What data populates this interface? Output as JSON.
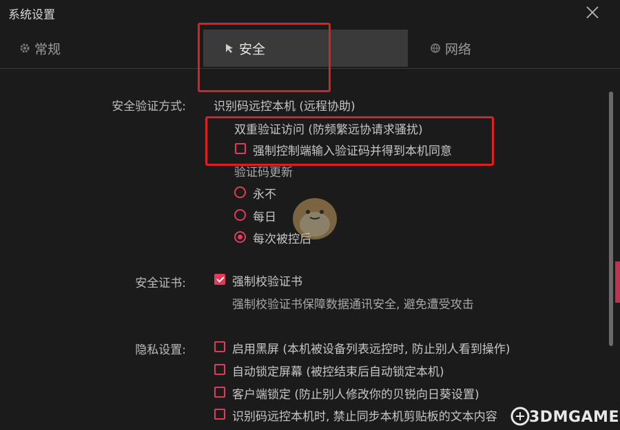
{
  "window": {
    "title": "系统设置"
  },
  "tabs": [
    {
      "label": "常规",
      "icon": "gear-icon"
    },
    {
      "label": "安全",
      "icon": "shield-arrow-icon"
    },
    {
      "label": "网络",
      "icon": "globe-icon"
    }
  ],
  "security": {
    "verify_method": {
      "label": "安全验证方式:",
      "value": "识别码远控本机 (远程协助)",
      "double_verify_title": "双重验证访问 (防频繁远协请求骚扰)",
      "force_code_option": "强制控制端输入验证码并得到本机同意",
      "force_code_checked": false,
      "code_update_title": "验证码更新",
      "code_update_options": [
        "永不",
        "每日",
        "每次被控后"
      ],
      "code_update_selected": "每次被控后"
    },
    "certificate": {
      "label": "安全证书:",
      "option": "强制校验证书",
      "checked": true,
      "description": "强制校验证书保障数据通讯安全, 避免遭受攻击"
    },
    "privacy": {
      "label": "隐私设置:",
      "options": [
        {
          "label": "启用黑屏 (本机被设备列表远控时, 防止别人看到操作)",
          "checked": false
        },
        {
          "label": "自动锁定屏幕 (被控结束后自动锁定本机)",
          "checked": false
        },
        {
          "label": "客户端锁定 (防止别人修改你的贝锐向日葵设置)",
          "checked": false
        },
        {
          "label": "识别码远控本机时, 禁止同步本机剪贴板的文本内容",
          "checked": false
        }
      ]
    }
  },
  "watermark": {
    "text": "3DMGAME"
  },
  "colors": {
    "accent": "#e5395a",
    "highlight_box": "#e02020",
    "background": "#1b1b1b",
    "active_tab": "#3a3a3a"
  }
}
